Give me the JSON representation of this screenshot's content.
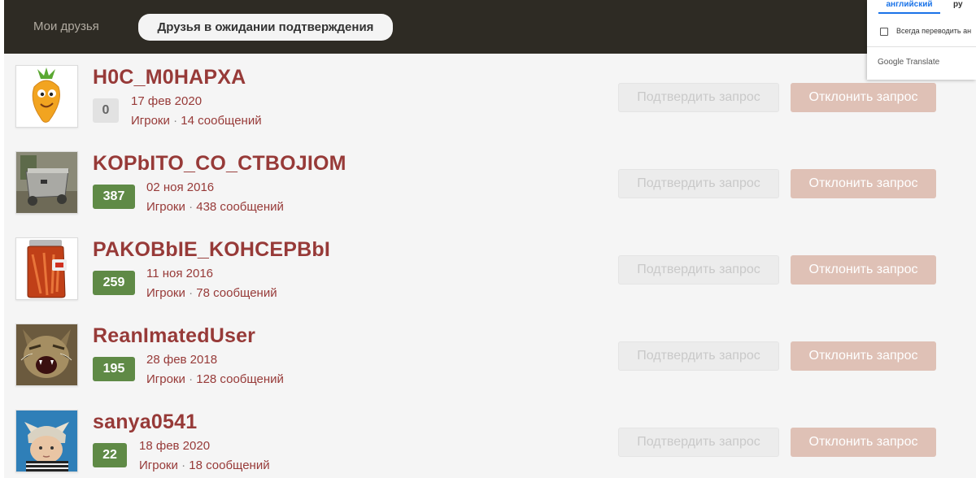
{
  "tabs": {
    "my_friends": "Мои друзья",
    "pending": "Друзья в ожидании подтверждения"
  },
  "buttons": {
    "confirm": "Подтвердить запрос",
    "reject": "Отклонить запрос"
  },
  "requests": [
    {
      "username": "H0C_M0HAPXA",
      "reputation": "0",
      "date": "17 фев 2020",
      "group": "Игроки",
      "messages": "14 сообщений",
      "avatar": "carrot-avatar"
    },
    {
      "username": "KOPbITO_CO_CTBOJIOM",
      "reputation": "387",
      "date": "02 ноя 2016",
      "group": "Игроки",
      "messages": "438 сообщений",
      "avatar": "trough-avatar"
    },
    {
      "username": "PAKOBbIE_KOHCEPBbI",
      "reputation": "259",
      "date": "11 ноя 2016",
      "group": "Игроки",
      "messages": "78 сообщений",
      "avatar": "jar-avatar"
    },
    {
      "username": "ReanImatedUser",
      "reputation": "195",
      "date": "28 фев 2018",
      "group": "Игроки",
      "messages": "128 сообщений",
      "avatar": "cat-avatar"
    },
    {
      "username": "sanya0541",
      "reputation": "22",
      "date": "18 фев 2020",
      "group": "Игроки",
      "messages": "18 сообщений",
      "avatar": "baby-avatar"
    }
  ],
  "separator": "·",
  "translate_popup": {
    "lang_english": "английский",
    "lang_russian": "ру",
    "always_translate": "Всегда переводить ан",
    "brand": "Google Translate"
  },
  "colors": {
    "username": "#973a38",
    "reputation_badge": "#5f8a46",
    "reject_button": "#dfc1b6",
    "topbar": "#2e2b24"
  }
}
